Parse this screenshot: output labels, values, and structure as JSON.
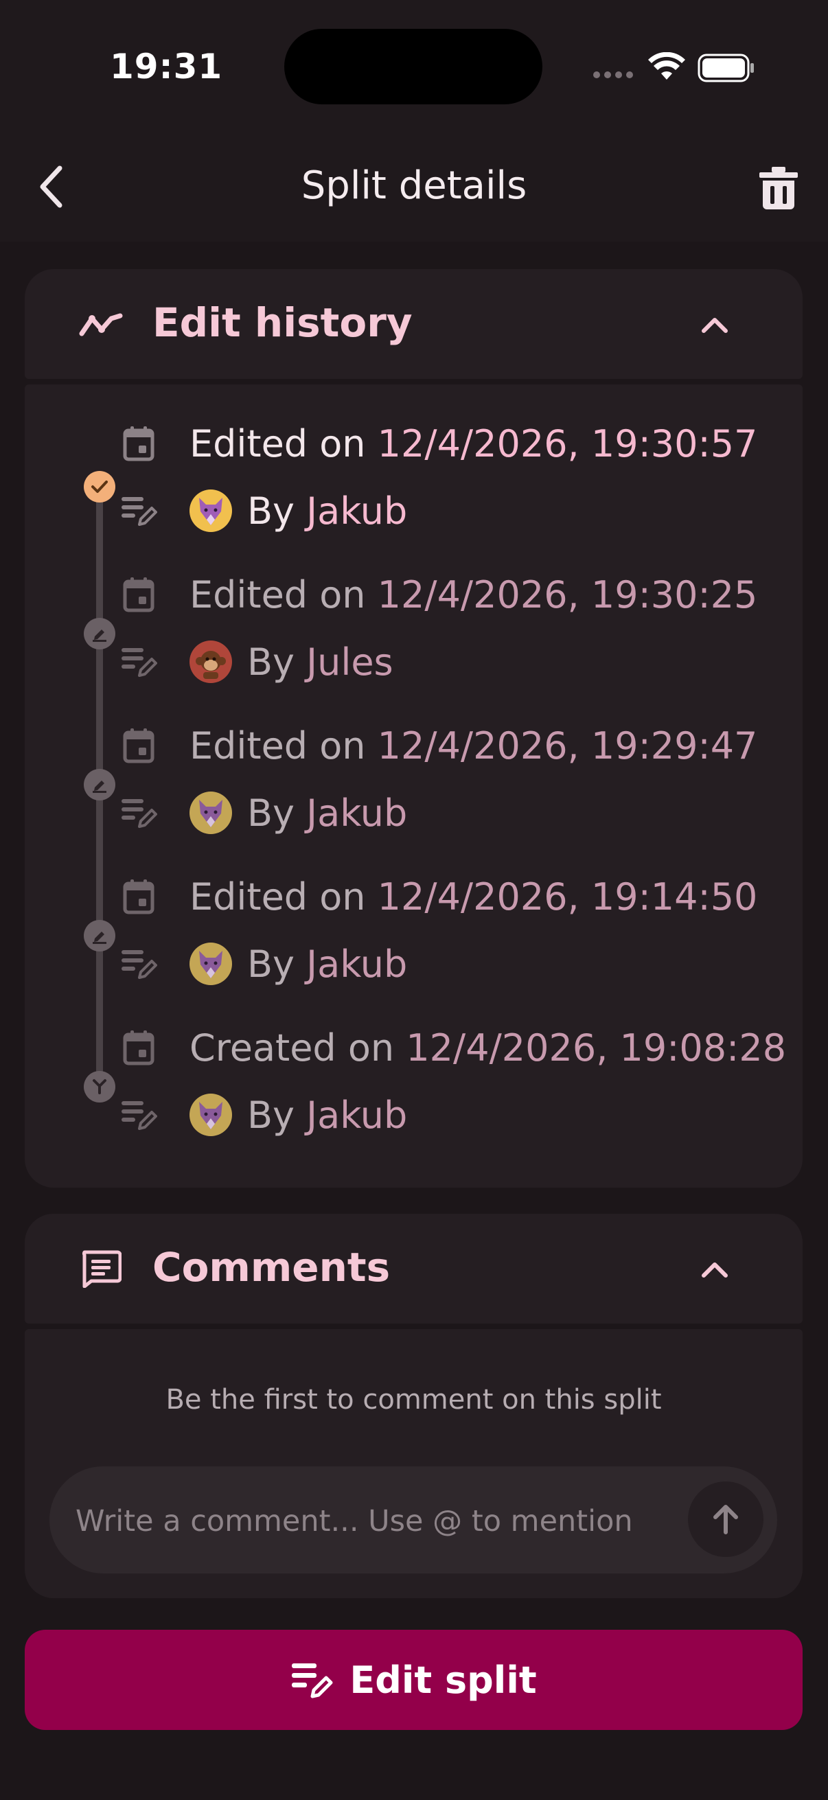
{
  "status_bar": {
    "time": "19:31"
  },
  "header": {
    "title": "Split details"
  },
  "edit_history": {
    "title": "Edit history",
    "entries": [
      {
        "label": "Edited on ",
        "datetime": "12/4/2026, 19:30:57",
        "by": "By ",
        "user": "Jakub",
        "marker": "check-icon",
        "current": true
      },
      {
        "label": "Edited on ",
        "datetime": "12/4/2026, 19:30:25",
        "by": "By ",
        "user": "Jules",
        "marker": "edit-icon",
        "current": false
      },
      {
        "label": "Edited on ",
        "datetime": "12/4/2026, 19:29:47",
        "by": "By ",
        "user": "Jakub",
        "marker": "edit-icon",
        "current": false
      },
      {
        "label": "Edited on ",
        "datetime": "12/4/2026, 19:14:50",
        "by": "By ",
        "user": "Jakub",
        "marker": "edit-icon",
        "current": false
      },
      {
        "label": "Created on ",
        "datetime": "12/4/2026, 19:08:28",
        "by": "By ",
        "user": "Jakub",
        "marker": "merge-icon",
        "current": false
      }
    ]
  },
  "comments": {
    "title": "Comments",
    "empty_text": "Be the first to comment on this split",
    "input_placeholder": "Write a comment... Use @ to mention"
  },
  "actions": {
    "edit_split_label": "Edit split"
  },
  "colors": {
    "accent": "#93004a",
    "highlight": "#f6b9cf",
    "current_marker": "#f3b07a",
    "background": "#1c1619"
  }
}
